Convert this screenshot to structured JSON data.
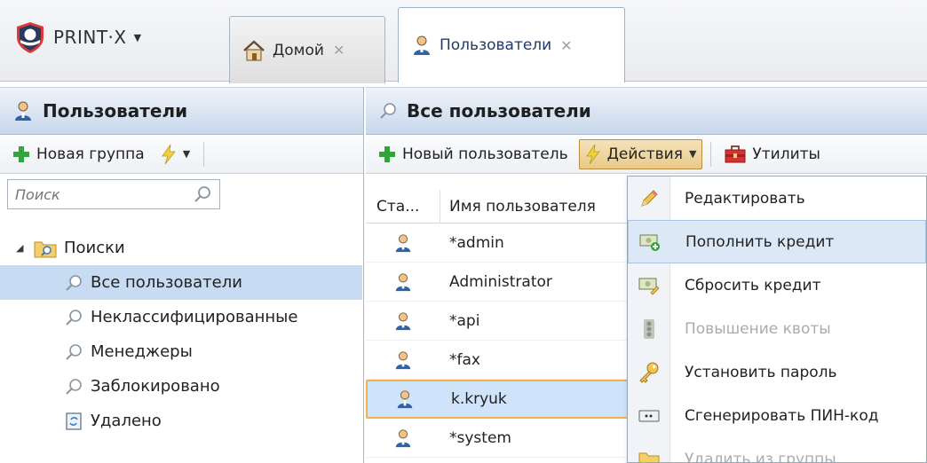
{
  "app": {
    "logo_text": "PRINT·X"
  },
  "tabs": [
    {
      "label": "Домой"
    },
    {
      "label": "Пользователи"
    }
  ],
  "left_panel": {
    "title": "Пользователи",
    "toolbar": {
      "new_group_label": "Новая группа"
    },
    "search": {
      "placeholder": "Поиск"
    },
    "tree": {
      "root_label": "Поиски",
      "items": [
        {
          "label": "Все пользователи",
          "selected": true
        },
        {
          "label": "Неклассифицированные"
        },
        {
          "label": "Менеджеры"
        },
        {
          "label": "Заблокировано"
        }
      ],
      "deleted_label": "Удалено"
    }
  },
  "right_panel": {
    "title": "Все пользователи",
    "toolbar": {
      "new_user_label": "Новый пользователь",
      "actions_label": "Действия",
      "utilities_label": "Утилиты"
    },
    "grid": {
      "columns": [
        "Ста...",
        "Имя пользователя"
      ],
      "rows": [
        {
          "name": "*admin"
        },
        {
          "name": "Administrator"
        },
        {
          "name": "*api"
        },
        {
          "name": "*fax"
        },
        {
          "name": "k.kryuk",
          "selected": true
        },
        {
          "name": "*system"
        }
      ]
    }
  },
  "actions_menu": {
    "items": [
      {
        "label": "Редактировать",
        "icon": "pencil-icon"
      },
      {
        "label": "Пополнить кредит",
        "icon": "add-credit-icon",
        "hover": true
      },
      {
        "label": "Сбросить кредит",
        "icon": "reset-credit-icon"
      },
      {
        "label": "Повышение квоты",
        "icon": "quota-icon",
        "disabled": true
      },
      {
        "label": "Установить пароль",
        "icon": "key-icon"
      },
      {
        "label": "Сгенерировать ПИН-код",
        "icon": "pin-icon"
      },
      {
        "label": "Удалить из группы",
        "icon": "remove-group-icon",
        "disabled": true
      }
    ]
  },
  "colors": {
    "selection": "#c7dbf2",
    "selected_row_border": "#f2b24a",
    "header_gradient_end": "#c8d8ec",
    "logo_red": "#d83a3a",
    "logo_navy": "#2a3a5a"
  }
}
